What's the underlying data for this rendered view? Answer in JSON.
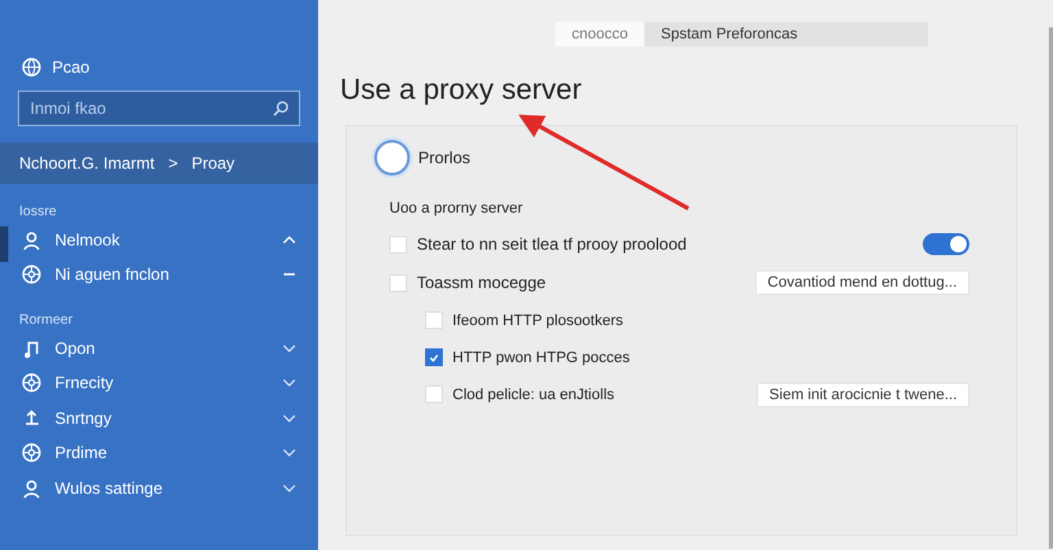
{
  "sidebar": {
    "header": "Pcao",
    "search": {
      "placeholder": "Inmoi fkao"
    },
    "breadcrumb": {
      "parent": "Nchoort.G. Imarmt",
      "separator": ">",
      "current": "Proay"
    },
    "sections": [
      {
        "title": "Iossre",
        "items": [
          {
            "label": "Nelmook",
            "expanded": true
          },
          {
            "label": "Ni aguen fnclon"
          }
        ]
      },
      {
        "title": "Rormeer",
        "items": [
          {
            "label": "Opon",
            "expanded": false
          },
          {
            "label": "Frnecity",
            "expanded": false
          },
          {
            "label": "Snrtngy",
            "expanded": false
          },
          {
            "label": "Prdime",
            "expanded": false
          },
          {
            "label": "Wulos sattinge",
            "expanded": false
          }
        ]
      }
    ]
  },
  "window": {
    "segments": [
      {
        "label": "cnoocco",
        "selected": true
      },
      {
        "label": "Spstam Preforoncas",
        "selected": false
      }
    ]
  },
  "page": {
    "title": "Use a proxy server",
    "radio": {
      "label": "Prorlos",
      "selected": false
    },
    "group_label": "Uoo a prorny server",
    "rows": [
      {
        "kind": "toggle",
        "label": "Stear to nn seit tlea tf prooy proolood",
        "checked": false,
        "on": true
      },
      {
        "kind": "button",
        "label": "Toassm mocegge",
        "checked": false,
        "button": "Covantiod mend en dottug...",
        "children": [
          {
            "kind": "plain",
            "label": "Ifeoom HTTP plosootkers",
            "checked": false
          },
          {
            "kind": "plain",
            "label": "HTTP pwon HTPG pocces",
            "checked": true
          },
          {
            "kind": "button",
            "label": "Clod pelicle: ua enJtiolls",
            "checked": false,
            "button": "Siem init arocicnie t twene..."
          }
        ]
      }
    ]
  }
}
